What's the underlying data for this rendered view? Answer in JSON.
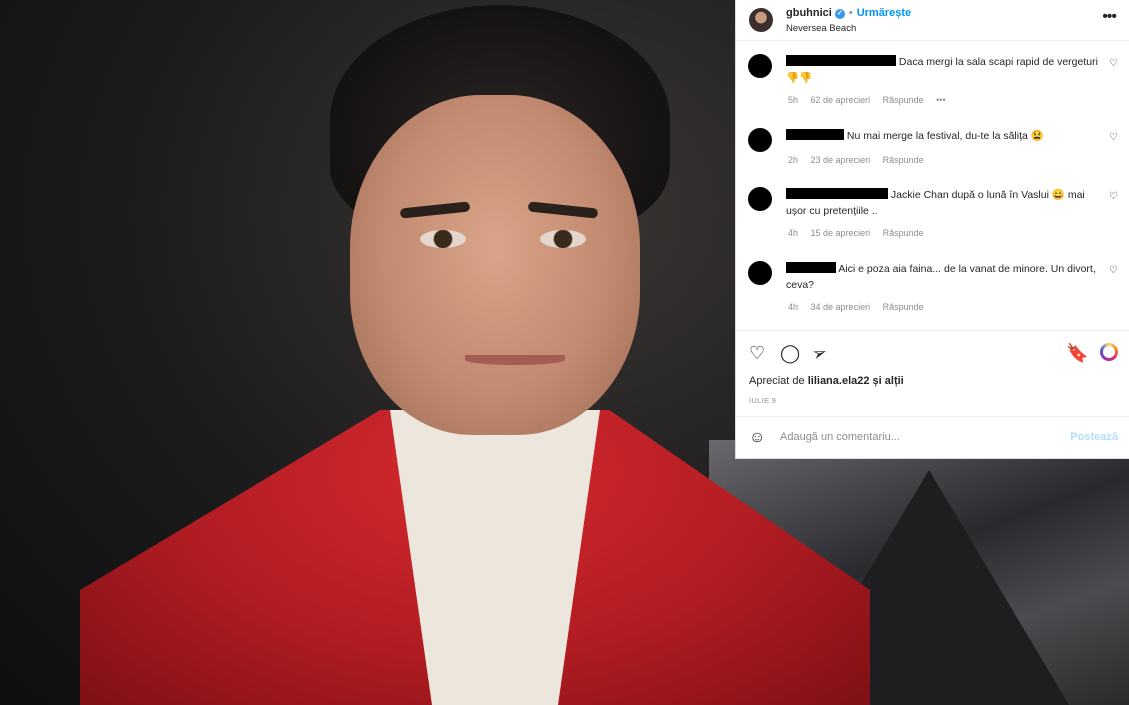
{
  "post": {
    "username": "gbuhnici",
    "follow_label": "Urmărește",
    "location": "Neversea Beach",
    "more_icon": "•••"
  },
  "comments": [
    {
      "text_pre": "",
      "text": "Daca mergi la sala scapi rapid de vergeturi👎👎",
      "time": "5h",
      "likes": "62 de aprecieri",
      "reply": "Răspunde",
      "more": "•••"
    },
    {
      "text": "Nu mai merge la festival, du-te la sălița 😫",
      "time": "2h",
      "likes": "23 de aprecieri",
      "reply": "Răspunde"
    },
    {
      "text": "Jackie Chan după o lună în Vaslui 😄 mai ușor cu pretențiile ..",
      "time": "4h",
      "likes": "15 de aprecieri",
      "reply": "Răspunde"
    },
    {
      "text": "Aici e poza aia faina... de la vanat de minore. Un divort, ceva?",
      "time": "4h",
      "likes": "34 de aprecieri",
      "reply": "Răspunde"
    }
  ],
  "actions": {
    "liked_by_prefix": "Apreciat de",
    "liked_by_user": "liliana.ela22",
    "liked_by_suffix": "și alții",
    "date": "IULIE 9"
  },
  "add_comment": {
    "placeholder": "Adaugă un comentariu...",
    "post_label": "Postează"
  },
  "colors": {
    "accent": "#0095f6",
    "sweater": "#c4202a"
  }
}
